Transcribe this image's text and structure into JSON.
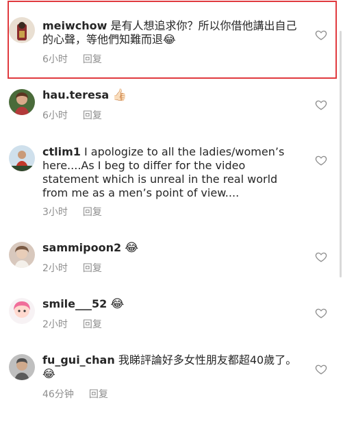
{
  "comments": [
    {
      "username": "meiwchow",
      "text": "是有人想追求你？所以你借他講出自己的心聲，等他們知難而退😂",
      "time": "6小时",
      "reply": "回复",
      "highlighted": true
    },
    {
      "username": "hau.teresa",
      "text": "👍🏻",
      "time": "6小时",
      "reply": "回复"
    },
    {
      "username": "ctlim1",
      "text": "I apologize to all the ladies/women’s here....As I beg to differ for the video statement which is unreal in the real world from me as a men’s point of view....",
      "time": "3小时",
      "reply": "回复"
    },
    {
      "username": "sammipoon2",
      "text": "😂",
      "time": "2小时",
      "reply": "回复"
    },
    {
      "username": "smile___52",
      "text": "😂",
      "time": "2小时",
      "reply": "回复"
    },
    {
      "username": "fu_gui_chan",
      "text": "我睇評論好多女性朋友都超40歲了。😂",
      "time": "46分钟",
      "reply": "回复"
    }
  ],
  "colors": {
    "highlight_border": "#e0393e",
    "meta_text": "#8e8e8e",
    "text": "#262626"
  }
}
